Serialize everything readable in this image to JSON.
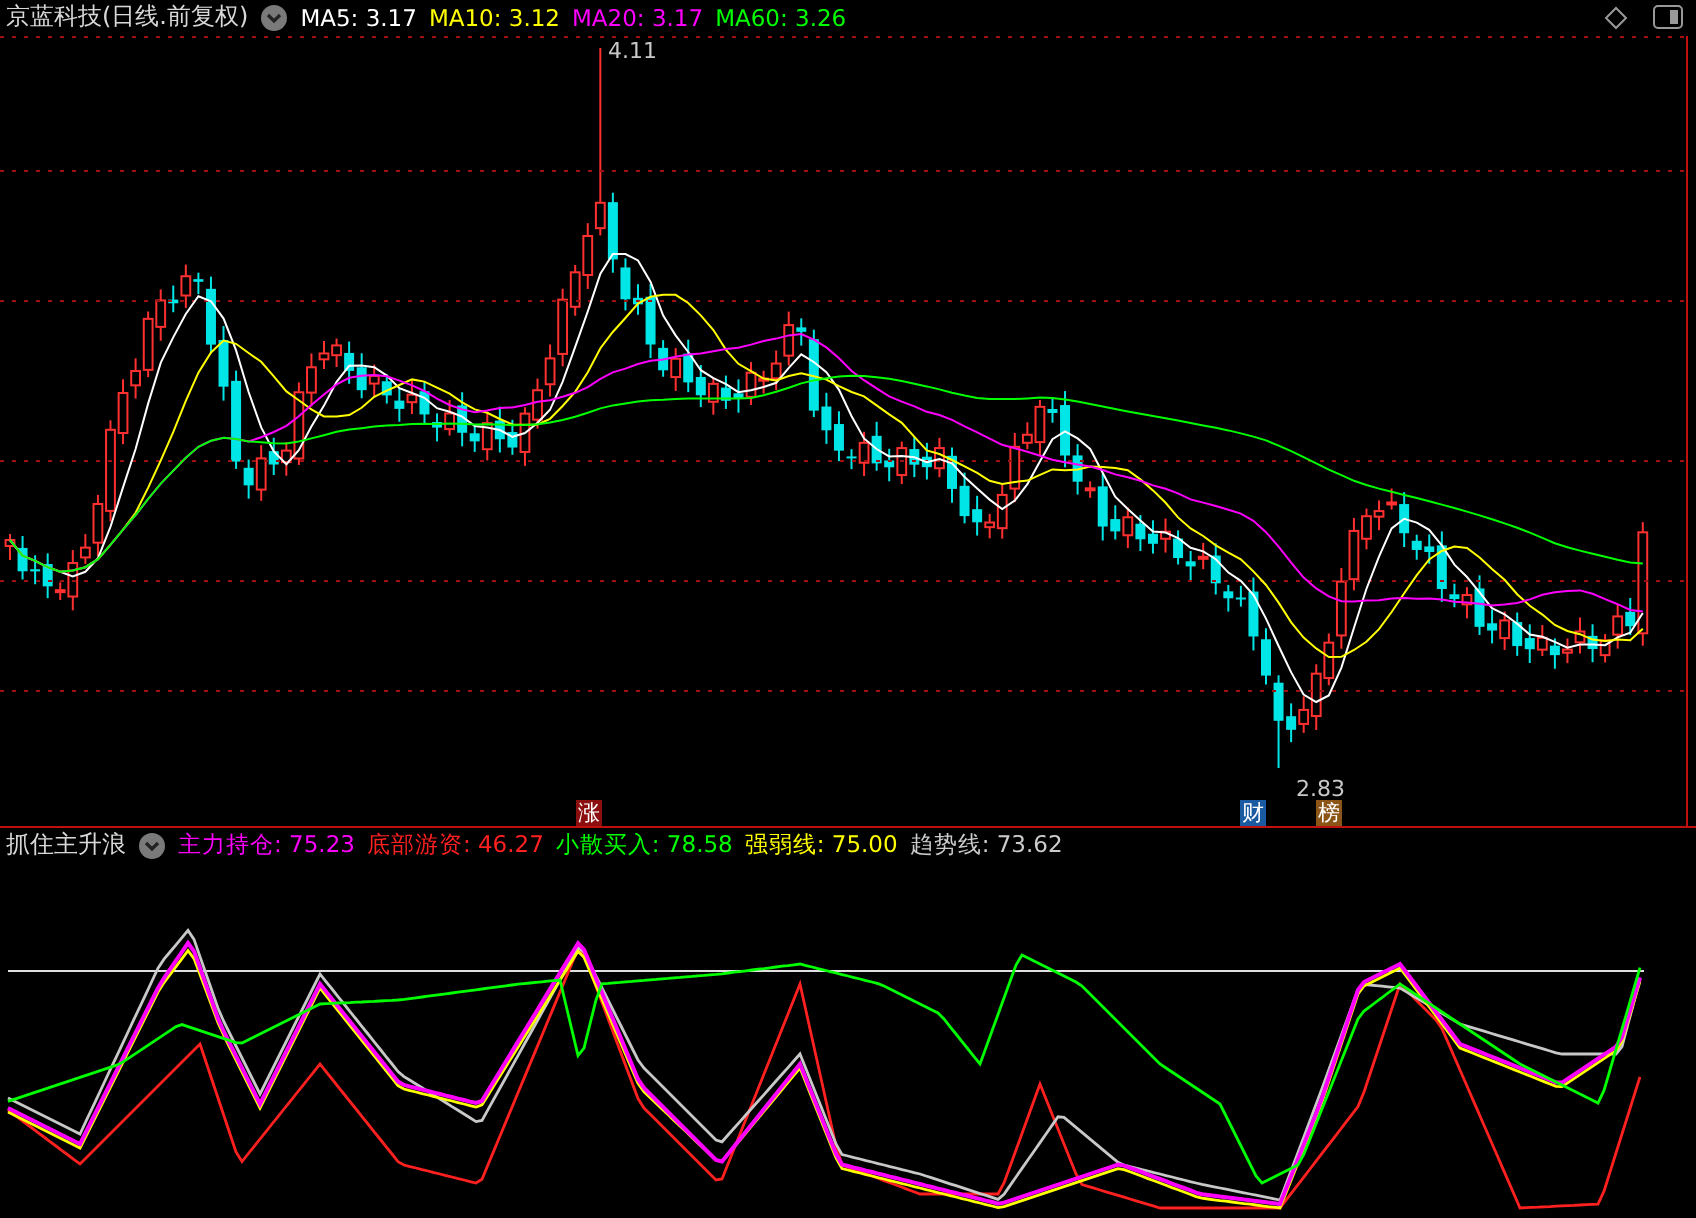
{
  "main_chart": {
    "title": "京蓝科技(日线.前复权)",
    "indicators": [
      {
        "label": "MA5: 3.17",
        "color": "#ffffff"
      },
      {
        "label": "MA10: 3.12",
        "color": "#ffff00"
      },
      {
        "label": "MA20: 3.17",
        "color": "#ff00ff"
      },
      {
        "label": "MA60: 3.26",
        "color": "#00ff00"
      }
    ],
    "high_label": "4.11",
    "low_label": "2.83",
    "markers": [
      {
        "text": "涨",
        "color": "#8b0f0f"
      },
      {
        "text": "财",
        "color": "#1a5aa0"
      },
      {
        "text": "榜",
        "color": "#8b5518"
      }
    ]
  },
  "sub_chart": {
    "title": "抓住主升浪",
    "indicators": [
      {
        "label": "主力持仓: 75.23",
        "color": "#ff00ff"
      },
      {
        "label": "底部游资: 46.27",
        "color": "#ff2020"
      },
      {
        "label": "小散买入: 78.58",
        "color": "#00ff00"
      },
      {
        "label": "强弱线: 75.00",
        "color": "#ffff00"
      },
      {
        "label": "趋势线: 73.62",
        "color": "#cccccc"
      }
    ]
  }
}
